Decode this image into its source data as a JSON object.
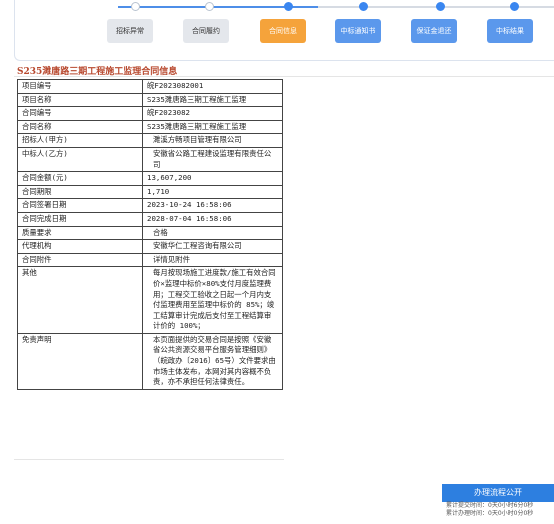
{
  "progress": {
    "steps": [
      {
        "label": "招标异常",
        "state": "normal"
      },
      {
        "label": "合同履约",
        "state": "normal"
      },
      {
        "label": "合同信息",
        "state": "active"
      },
      {
        "label": "中标通知书",
        "state": "blue"
      },
      {
        "label": "保证金退还",
        "state": "blue"
      },
      {
        "label": "中标结果",
        "state": "blue"
      }
    ]
  },
  "contract": {
    "title": "S235濉唐路三期工程施工监理合同信息",
    "rows": [
      {
        "key": "项目编号",
        "value": "皖F2023082001"
      },
      {
        "key": "项目名称",
        "value": "S235濉唐路三期工程施工监理"
      },
      {
        "key": "合同编号",
        "value": "皖F2023082"
      },
      {
        "key": "合同名称",
        "value": "S235濉唐路三期工程施工监理"
      },
      {
        "key": "招标人(甲方)",
        "value": "濉溪方畅项目管理有限公司"
      },
      {
        "key": "中标人(乙方)",
        "value": "安徽省公路工程建设监理有限责任公司"
      },
      {
        "key": "合同金额(元)",
        "value": "13,607,200"
      },
      {
        "key": "合同期限",
        "value": "1,710"
      },
      {
        "key": "合同签署日期",
        "value": "2023-10-24 16:58:06"
      },
      {
        "key": "合同完成日期",
        "value": "2028-07-04 16:58:06"
      },
      {
        "key": "质量要求",
        "value": "合格"
      },
      {
        "key": "代理机构",
        "value": "安徽华仁工程咨询有限公司"
      },
      {
        "key": "合同附件",
        "value": "详情见附件"
      },
      {
        "key": "其他",
        "value": "每月按现场施工进度款/施工有效合同价×监理中标价×80%支付月度监理费用；工程交工验收之日起一个月内支付监理费用至监理中标价的 85%；竣工结算审计完成后支付至工程结算审计价的 100%；"
      },
      {
        "key": "免责声明",
        "value": "本页面提供的交易合同是按照《安徽省公共资源交易平台服务管理细则》（皖政办〔2016〕65号）文件要求由市场主体发布，本网对其内容概不负责，亦不承担任何法律责任。"
      }
    ]
  },
  "side_panel": {
    "title": "办理流程公开",
    "line1": "累计提交时间：0天0小时6分0秒",
    "line2": "累计办理时间：0天0小时0分0秒"
  }
}
